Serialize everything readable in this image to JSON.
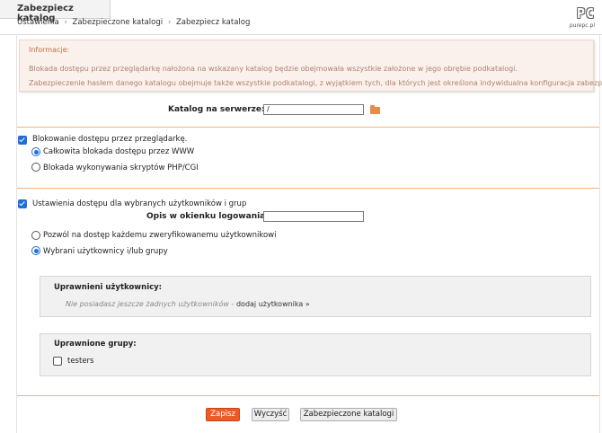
{
  "header": {
    "title": "Zabezpiecz katalog",
    "breadcrumb": [
      "Ustawienia",
      "Zabezpieczone katalogi",
      "Zabezpiecz katalog"
    ],
    "separator": "›",
    "logo": {
      "main": "PC",
      "sub": "purepc.pl"
    }
  },
  "info": {
    "title": "Informacje:",
    "lines": [
      "Blokada dostępu przez przeglądarkę nałożona na wskazany katalog będzie obejmowała wszystkie założone w jego obrębie podkatalogi.",
      "Zabezpieczenie hasłem danego katalogu obejmuje także wszystkie podkatalogi, z wyjątkiem tych, dla których jest określona indywidualna konfiguracja zabezpieczeń."
    ]
  },
  "catalog": {
    "label": "Katalog na serwerze:",
    "value": "/",
    "browse_icon": "folder-icon"
  },
  "browser_block": {
    "label": "Blokowanie dostępu przez przeglądarkę.",
    "checked": true,
    "options": [
      {
        "label": "Całkowita blokada dostępu przez WWW",
        "selected": true
      },
      {
        "label": "Blokada wykonywania skryptów PHP/CGI",
        "selected": false
      }
    ]
  },
  "access": {
    "label": "Ustawienia dostępu dla wybranych użytkowników i grup",
    "checked": true,
    "login_label": "Opis w okienku logowania:",
    "login_value": "",
    "options": [
      {
        "label": "Pozwól na dostęp każdemu zweryfikowanemu użytkownikowi",
        "selected": false
      },
      {
        "label": "Wybrani użytkownicy i/lub grupy",
        "selected": true
      }
    ]
  },
  "users_panel": {
    "title": "Uprawnieni użytkownicy:",
    "empty_text": "Nie posiadasz jeszcze żadnych użytkowników",
    "dash": " - ",
    "link": "dodaj użytkownika »"
  },
  "groups_panel": {
    "title": "Uprawnione grupy:",
    "groups": [
      {
        "name": "testers",
        "checked": false
      }
    ]
  },
  "buttons": {
    "save": "Zapisz",
    "clear": "Wyczyść",
    "back": "Zabezpieczone katalogi"
  },
  "colors": {
    "accent": "#ee5a24",
    "check_blue": "#1e6fd9",
    "divider": "#efb07e",
    "info_bg": "#fbf1ec"
  }
}
